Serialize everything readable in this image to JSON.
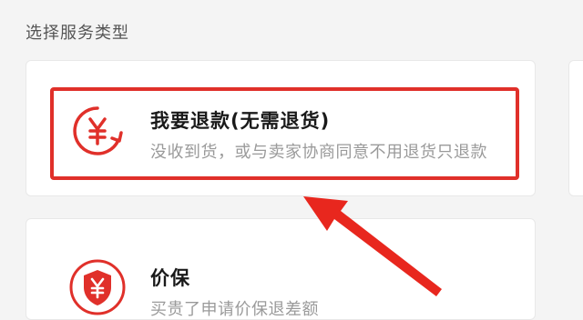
{
  "header": {
    "title": "选择服务类型"
  },
  "options": [
    {
      "title": "我要退款(无需退货)",
      "description": "没收到货，或与卖家协商同意不用退货只退款",
      "icon": "yen-refund-icon"
    },
    {
      "title": "价保",
      "description": "买贵了申请价保退差额",
      "icon": "yen-shield-icon"
    }
  ],
  "colors": {
    "accent": "#e0302a",
    "title": "#1a1a1a",
    "description": "#9a9a9a"
  }
}
